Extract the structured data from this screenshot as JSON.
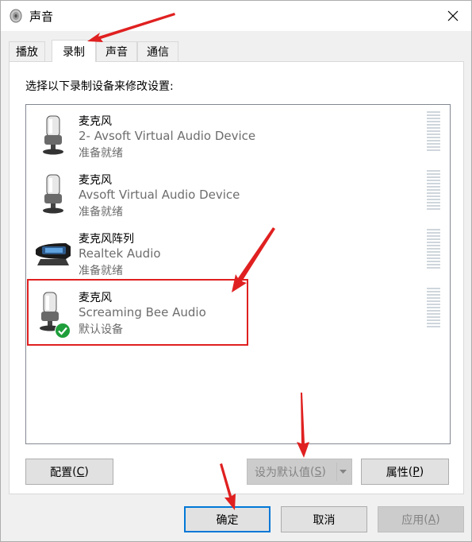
{
  "window": {
    "title": "声音",
    "close_label": "×"
  },
  "tabs": [
    {
      "label": "播放",
      "active": false
    },
    {
      "label": "录制",
      "active": true
    },
    {
      "label": "声音",
      "active": false
    },
    {
      "label": "通信",
      "active": false
    }
  ],
  "instruction": "选择以下录制设备来修改设置:",
  "devices": [
    {
      "name": "麦克风",
      "description": "2- Avsoft Virtual Audio Device",
      "status": "准备就绪",
      "icon": "microphone-icon",
      "default": false
    },
    {
      "name": "麦克风",
      "description": "Avsoft Virtual Audio Device",
      "status": "准备就绪",
      "icon": "microphone-icon",
      "default": false
    },
    {
      "name": "麦克风阵列",
      "description": "Realtek Audio",
      "status": "准备就绪",
      "icon": "webcam-array-icon",
      "default": false
    },
    {
      "name": "麦克风",
      "description": "Screaming Bee Audio",
      "status": "默认设备",
      "icon": "microphone-icon",
      "default": true
    }
  ],
  "buttons": {
    "configure": {
      "label": "配置",
      "hotkey": "C"
    },
    "set_default": {
      "label": "设为默认值",
      "hotkey": "S",
      "enabled": false
    },
    "properties": {
      "label": "属性",
      "hotkey": "P"
    },
    "ok": {
      "label": "确定"
    },
    "cancel": {
      "label": "取消"
    },
    "apply": {
      "label": "应用",
      "hotkey": "A",
      "enabled": false
    }
  },
  "colors": {
    "annotation_red": "#e02020",
    "accent": "#0078d7",
    "default_check": "#1e9e3a"
  }
}
